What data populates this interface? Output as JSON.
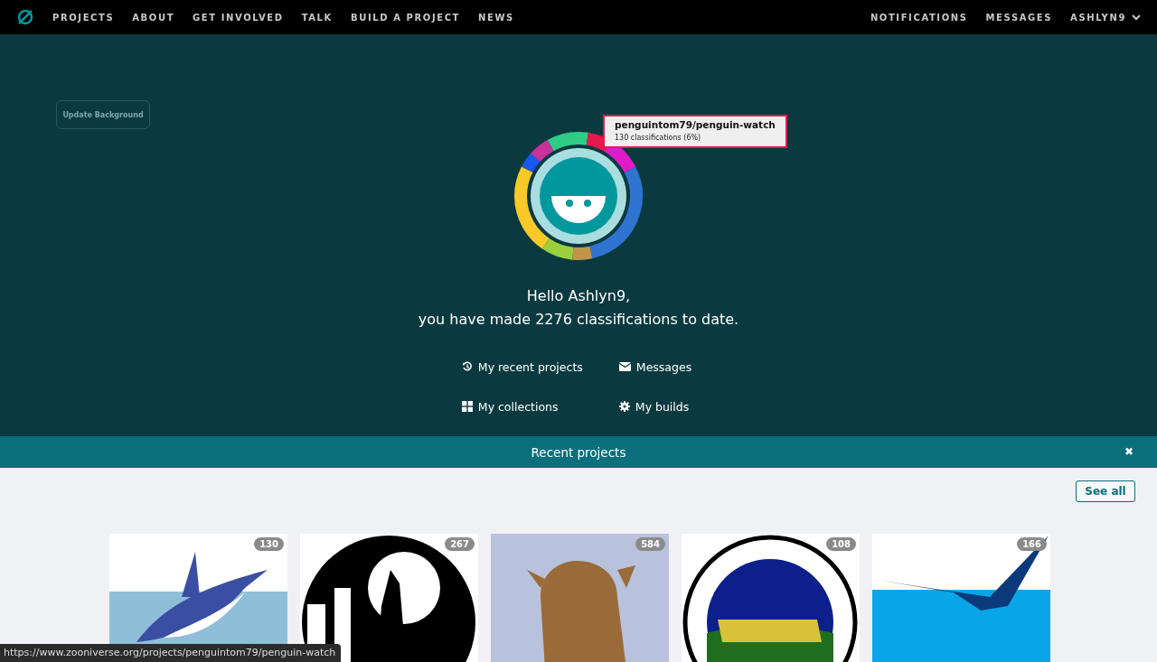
{
  "nav": {
    "links": [
      {
        "label": "PROJECTS"
      },
      {
        "label": "ABOUT"
      },
      {
        "label": "GET INVOLVED"
      },
      {
        "label": "TALK"
      },
      {
        "label": "BUILD A PROJECT"
      },
      {
        "label": "NEWS"
      }
    ],
    "right": [
      {
        "label": "NOTIFICATIONS"
      },
      {
        "label": "MESSAGES"
      }
    ],
    "user": "ASHLYN9"
  },
  "hero": {
    "update_button": "Update Background",
    "tooltip": {
      "title": "penguintom79/penguin-watch",
      "detail": "130 classifications (6%)"
    },
    "greeting": "Hello Ashlyn9,",
    "summary": "you have made 2276 classifications to date.",
    "links": [
      {
        "kind": "history",
        "label": "My recent projects"
      },
      {
        "kind": "mail",
        "label": "Messages"
      },
      {
        "kind": "grid",
        "label": "My collections"
      },
      {
        "kind": "gear",
        "label": "My builds"
      }
    ]
  },
  "recent": {
    "title": "Recent projects",
    "close": "✖",
    "see_all": "See all",
    "projects": [
      {
        "kind": "penguin",
        "count": "130"
      },
      {
        "kind": "wolf",
        "count": "267"
      },
      {
        "kind": "giraffe",
        "count": "584"
      },
      {
        "kind": "lakes",
        "count": "108"
      },
      {
        "kind": "seabird",
        "count": "166"
      }
    ]
  },
  "status_bar": "https://www.zooniverse.org/projects/penguintom79/penguin-watch"
}
